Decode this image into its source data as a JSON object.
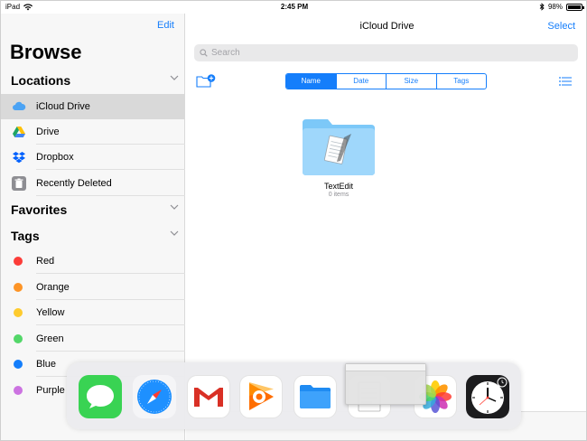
{
  "status_bar": {
    "device": "iPad",
    "time": "2:45 PM",
    "battery": "98%",
    "battery_level": 0.98
  },
  "sidebar": {
    "edit_label": "Edit",
    "title": "Browse",
    "locations": {
      "heading": "Locations",
      "items": [
        {
          "label": "iCloud Drive",
          "icon": "icloud-icon",
          "selected": true
        },
        {
          "label": "Drive",
          "icon": "google-drive-icon",
          "selected": false
        },
        {
          "label": "Dropbox",
          "icon": "dropbox-icon",
          "selected": false
        },
        {
          "label": "Recently Deleted",
          "icon": "trash-icon",
          "selected": false
        }
      ]
    },
    "favorites": {
      "heading": "Favorites"
    },
    "tags": {
      "heading": "Tags",
      "items": [
        {
          "label": "Red",
          "color": "#fc3d39"
        },
        {
          "label": "Orange",
          "color": "#fd9426"
        },
        {
          "label": "Yellow",
          "color": "#fecb2e"
        },
        {
          "label": "Green",
          "color": "#53d769"
        },
        {
          "label": "Blue",
          "color": "#147efb"
        },
        {
          "label": "Purple",
          "color": "#cc73e1"
        }
      ]
    }
  },
  "main": {
    "title": "iCloud Drive",
    "select_label": "Select",
    "search_placeholder": "Search",
    "sort": {
      "options": [
        "Name",
        "Date",
        "Size",
        "Tags"
      ],
      "selected": "Name"
    },
    "items": [
      {
        "name": "TextEdit",
        "subtitle": "0 items",
        "icon": "folder-icon"
      }
    ]
  },
  "dock": {
    "apps": [
      {
        "icon": "messages-icon"
      },
      {
        "icon": "safari-icon"
      },
      {
        "icon": "gmail-icon"
      },
      {
        "icon": "google-play-music-icon"
      },
      {
        "icon": "files-icon"
      },
      {
        "icon": "textedit-icon"
      },
      {
        "icon": "photos-icon"
      },
      {
        "icon": "clock-icon"
      }
    ]
  },
  "colors": {
    "accent": "#157efb",
    "sidebar_bg": "#f7f7f7",
    "selected_row": "#d9d9d9"
  }
}
